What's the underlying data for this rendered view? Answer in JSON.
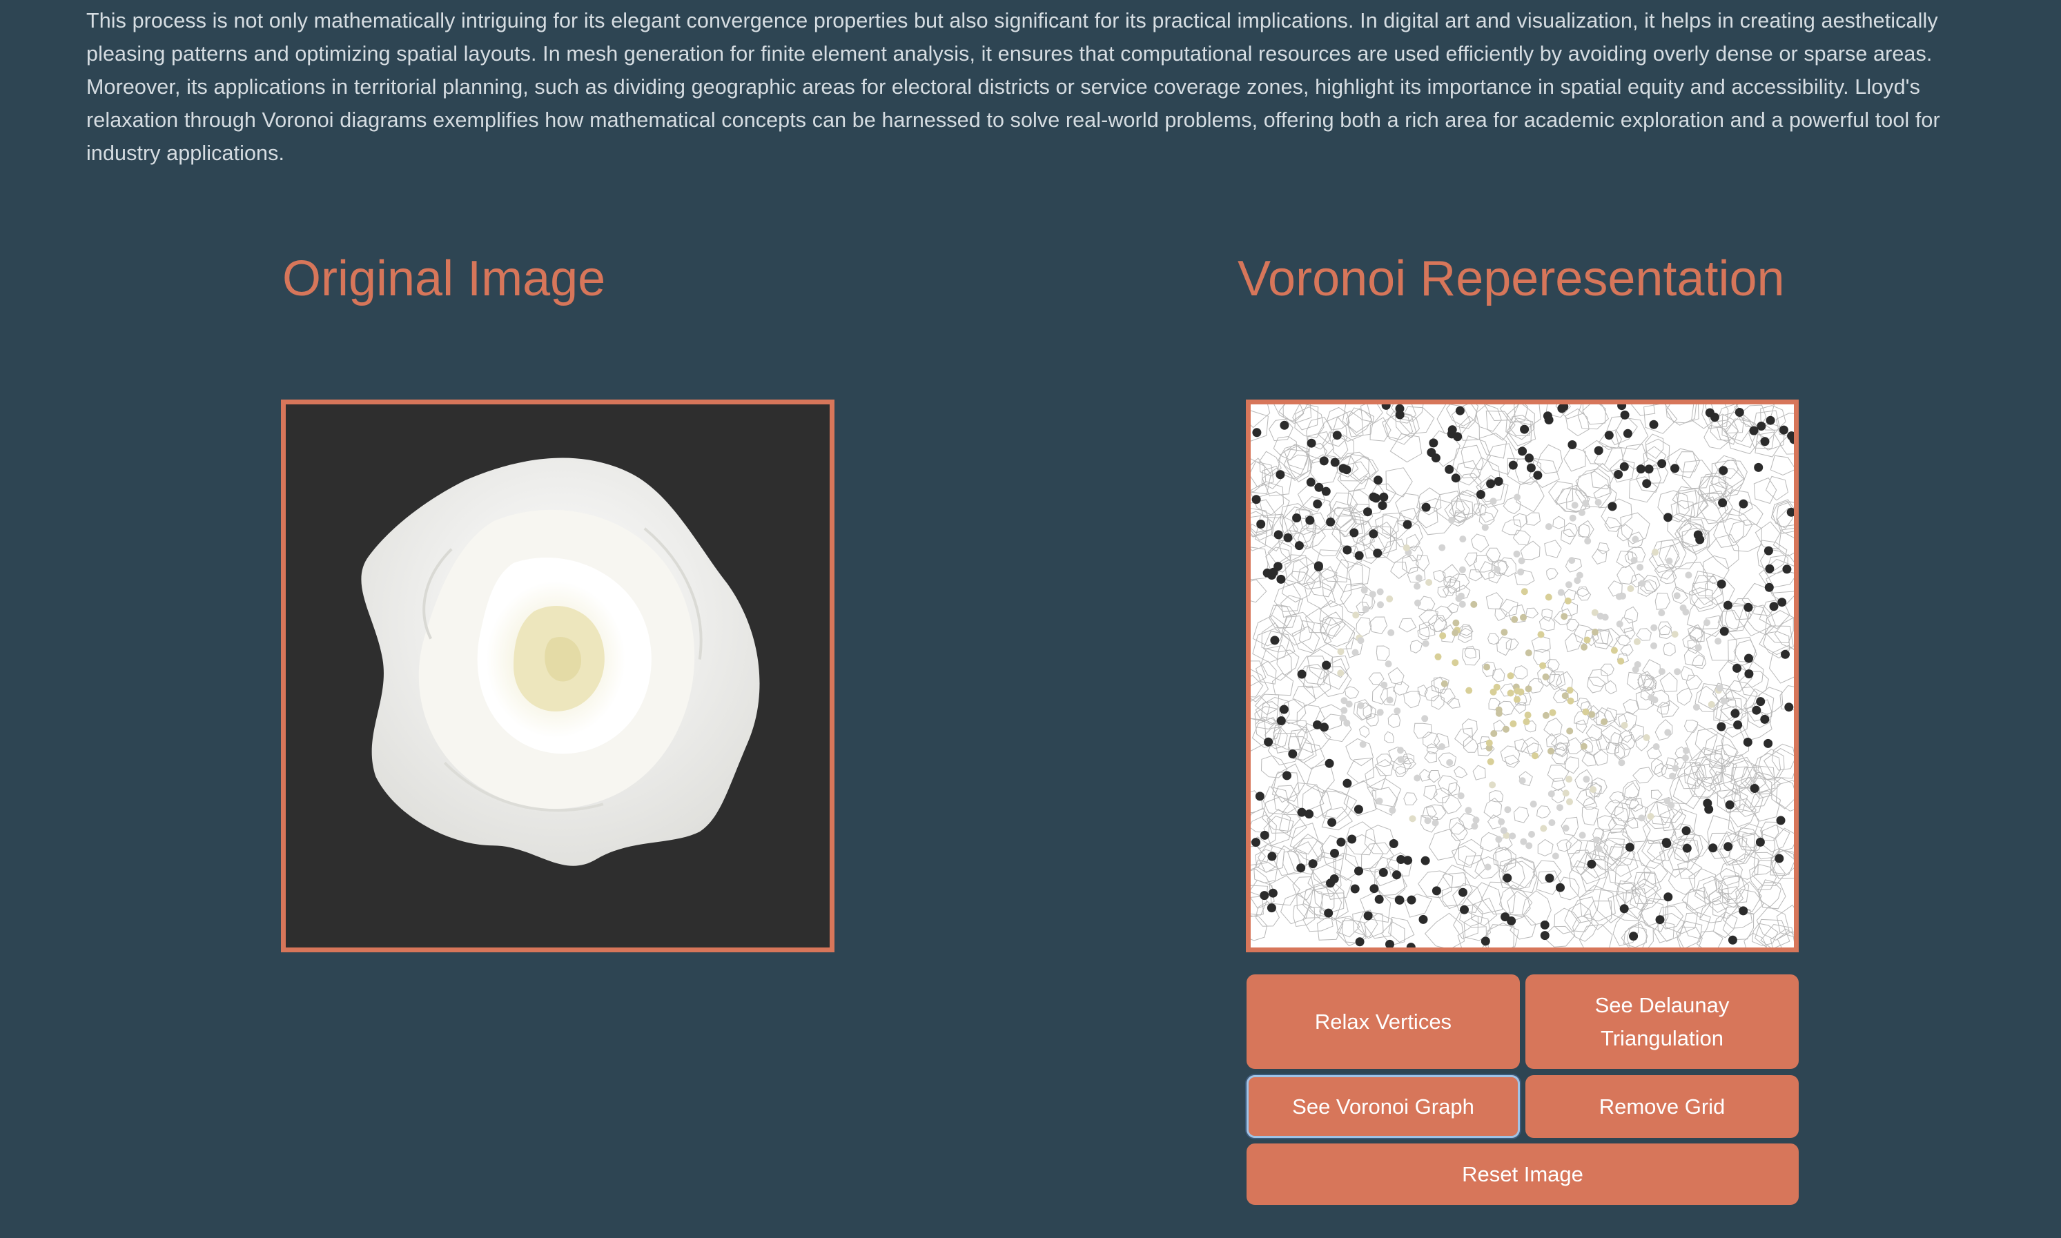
{
  "intro": {
    "text": "This process is not only mathematically intriguing for its elegant convergence properties but also significant for its practical implications. In digital art and visualization, it helps in creating aesthetically pleasing patterns and optimizing spatial layouts. In mesh generation for finite element analysis, it ensures that computational resources are used efficiently by avoiding overly dense or sparse areas. Moreover, its applications in territorial planning, such as dividing geographic areas for electoral districts or service coverage zones, highlight its importance in spatial equity and accessibility. Lloyd's relaxation through Voronoi diagrams exemplifies how mathematical concepts can be harnessed to solve real-world problems, offering both a rich area for academic exploration and a powerful tool for industry applications."
  },
  "original_panel": {
    "title": "Original Image"
  },
  "voronoi_panel": {
    "title": "Voronoi Reperesentation"
  },
  "buttons": {
    "relax": "Relax Vertices",
    "delaunay": "See Delaunay Triangulation",
    "voronoi_graph": "See Voronoi Graph",
    "remove_grid": "Remove Grid",
    "reset": "Reset Image"
  },
  "colors": {
    "background": "#2e4553",
    "accent": "#d7765a",
    "image_background": "#2e2e2e",
    "focus_ring": "#9fc3e6"
  },
  "icons": {
    "original": "white-rose-image",
    "voronoi": "voronoi-diagram-image"
  }
}
